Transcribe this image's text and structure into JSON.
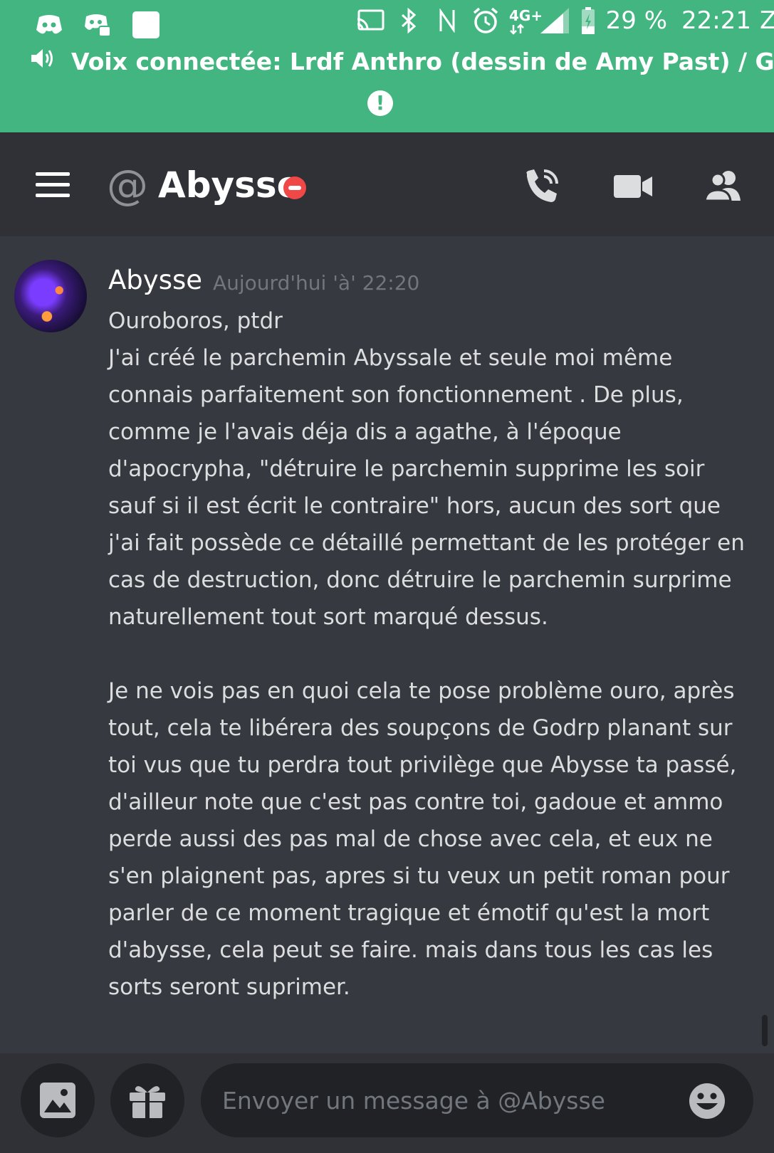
{
  "status_bar": {
    "battery": "29 %",
    "time": "22:21",
    "network": "4G+"
  },
  "voice": {
    "label": "Voix connectée: Lrdf Anthro (dessin de Amy Past) / Gén..."
  },
  "header": {
    "title": "Abysse",
    "status": "dnd"
  },
  "message": {
    "author": "Abysse",
    "timestamp": "Aujourd'hui 'à' 22:20",
    "paragraphs": [
      "Ouroboros, ptdr",
      "J'ai créé le parchemin Abyssale et seule moi même connais parfaitement son fonctionnement . De plus, comme je l'avais déja dis a agathe, à l'époque d'apocrypha, \"détruire le parchemin supprime les soir sauf si il est écrit le contraire\" hors, aucun des sort que j'ai fait possède ce détaillé permettant de les protéger en cas de destruction, donc détruire le parchemin surprime naturellement tout sort marqué dessus.",
      "Je ne vois pas en quoi cela te pose problème ouro, après tout, cela te libérera des soupçons de Godrp planant sur toi vus que tu perdra tout privilège que Abysse ta passé, d'ailleur note que c'est pas contre toi, gadoue et ammo perde aussi des pas mal de chose avec cela, et eux ne s'en plaignent pas, apres si tu veux un petit roman pour parler de ce moment tragique et émotif qu'est la mort d'abysse, cela peut se faire. mais dans tous les cas les sorts seront suprimer."
    ]
  },
  "composer": {
    "placeholder": "Envoyer un message à @Abysse"
  }
}
